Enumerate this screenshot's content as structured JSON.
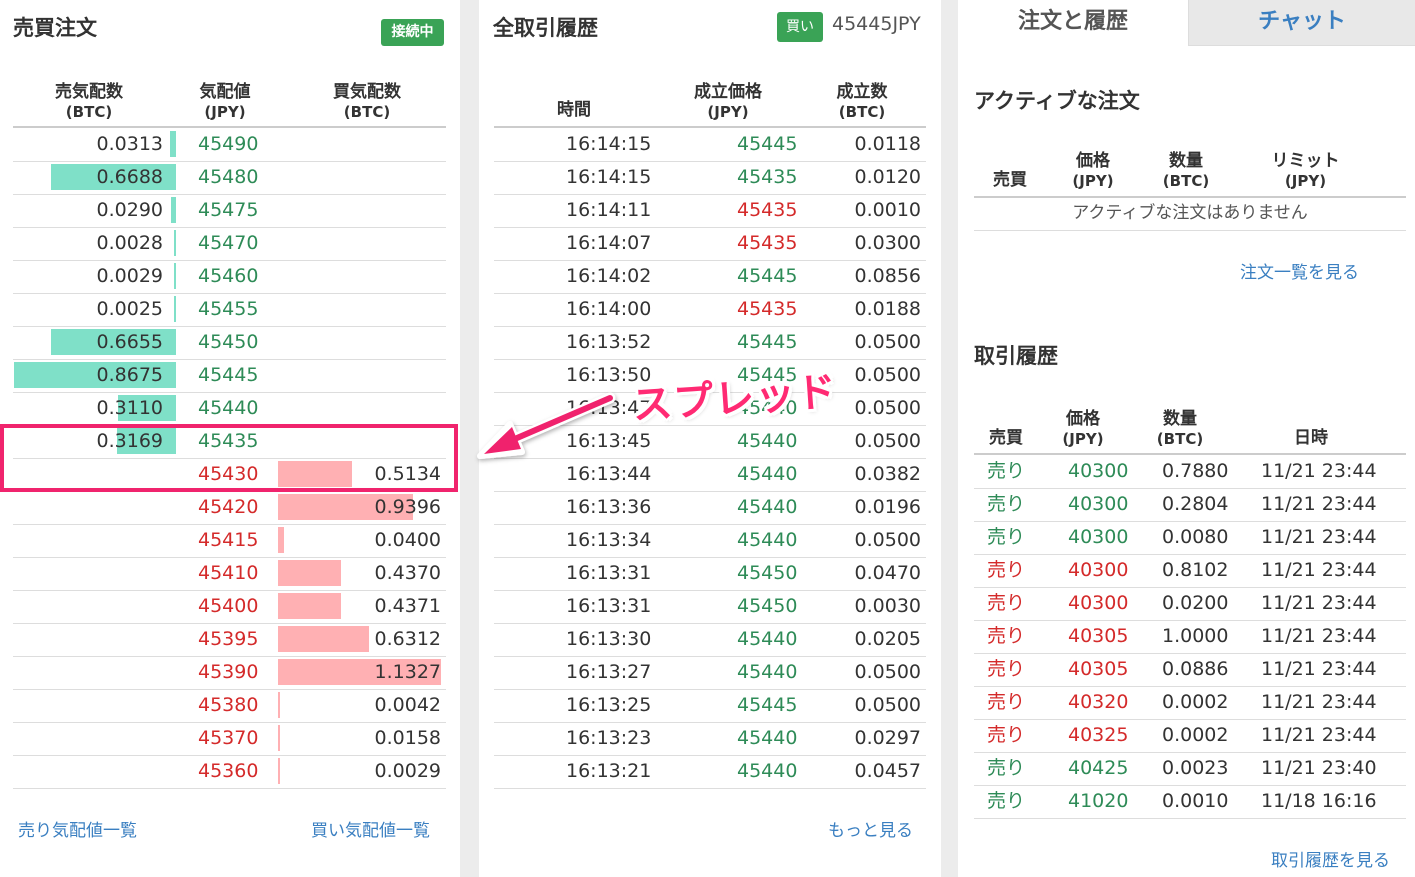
{
  "orderbook": {
    "title": "売買注文",
    "status_badge": "接続中",
    "headers": {
      "ask_qty": "売気配数",
      "ask_qty_unit": "(BTC)",
      "price": "気配値",
      "price_unit": "(JPY)",
      "bid_qty": "買気配数",
      "bid_qty_unit": "(BTC)"
    },
    "asks": [
      {
        "qty": "0.0313",
        "price": "45490",
        "level": 0.036
      },
      {
        "qty": "0.6688",
        "price": "45480",
        "level": 0.77
      },
      {
        "qty": "0.0290",
        "price": "45475",
        "level": 0.033
      },
      {
        "qty": "0.0028",
        "price": "45470",
        "level": 0.005
      },
      {
        "qty": "0.0029",
        "price": "45460",
        "level": 0.005
      },
      {
        "qty": "0.0025",
        "price": "45455",
        "level": 0.005
      },
      {
        "qty": "0.6655",
        "price": "45450",
        "level": 0.77
      },
      {
        "qty": "0.8675",
        "price": "45445",
        "level": 1.0
      },
      {
        "qty": "0.3110",
        "price": "45440",
        "level": 0.36
      },
      {
        "qty": "0.3169",
        "price": "45435",
        "level": 0.365
      }
    ],
    "bids": [
      {
        "price": "45430",
        "qty": "0.5134",
        "level": 0.453
      },
      {
        "price": "45420",
        "qty": "0.9396",
        "level": 0.83
      },
      {
        "price": "45415",
        "qty": "0.0400",
        "level": 0.035
      },
      {
        "price": "45410",
        "qty": "0.4370",
        "level": 0.386
      },
      {
        "price": "45400",
        "qty": "0.4371",
        "level": 0.386
      },
      {
        "price": "45395",
        "qty": "0.6312",
        "level": 0.557
      },
      {
        "price": "45390",
        "qty": "1.1327",
        "level": 1.0
      },
      {
        "price": "45380",
        "qty": "0.0042",
        "level": 0.004
      },
      {
        "price": "45370",
        "qty": "0.0158",
        "level": 0.014
      },
      {
        "price": "45360",
        "qty": "0.0029",
        "level": 0.003
      }
    ],
    "link_sell": "売り気配値一覧",
    "link_buy": "買い気配値一覧",
    "colors": {
      "ask_bar": "#7fe0c8",
      "bid_bar": "#ffb0b3",
      "highlight": "#f0246d"
    }
  },
  "annotation": {
    "spread_label": "スプレッド"
  },
  "trades": {
    "title": "全取引履歴",
    "side_badge": "買い",
    "last_price": "45445JPY",
    "headers": {
      "time": "時間",
      "price": "成立価格",
      "price_unit": "(JPY)",
      "qty": "成立数",
      "qty_unit": "(BTC)"
    },
    "rows": [
      {
        "time": "16:14:15",
        "price": "45445",
        "qty": "0.0118",
        "side": "buy"
      },
      {
        "time": "16:14:15",
        "price": "45435",
        "qty": "0.0120",
        "side": "buy"
      },
      {
        "time": "16:14:11",
        "price": "45435",
        "qty": "0.0010",
        "side": "sell"
      },
      {
        "time": "16:14:07",
        "price": "45435",
        "qty": "0.0300",
        "side": "sell"
      },
      {
        "time": "16:14:02",
        "price": "45445",
        "qty": "0.0856",
        "side": "buy"
      },
      {
        "time": "16:14:00",
        "price": "45435",
        "qty": "0.0188",
        "side": "sell"
      },
      {
        "time": "16:13:52",
        "price": "45445",
        "qty": "0.0500",
        "side": "buy"
      },
      {
        "time": "16:13:50",
        "price": "45445",
        "qty": "0.0500",
        "side": "buy"
      },
      {
        "time": "16:13:47",
        "price": "45440",
        "qty": "0.0500",
        "side": "buy"
      },
      {
        "time": "16:13:45",
        "price": "45440",
        "qty": "0.0500",
        "side": "buy"
      },
      {
        "time": "16:13:44",
        "price": "45440",
        "qty": "0.0382",
        "side": "buy"
      },
      {
        "time": "16:13:36",
        "price": "45440",
        "qty": "0.0196",
        "side": "buy"
      },
      {
        "time": "16:13:34",
        "price": "45440",
        "qty": "0.0500",
        "side": "buy"
      },
      {
        "time": "16:13:31",
        "price": "45450",
        "qty": "0.0470",
        "side": "buy"
      },
      {
        "time": "16:13:31",
        "price": "45450",
        "qty": "0.0030",
        "side": "buy"
      },
      {
        "time": "16:13:30",
        "price": "45440",
        "qty": "0.0205",
        "side": "buy"
      },
      {
        "time": "16:13:27",
        "price": "45440",
        "qty": "0.0500",
        "side": "buy"
      },
      {
        "time": "16:13:25",
        "price": "45445",
        "qty": "0.0500",
        "side": "buy"
      },
      {
        "time": "16:13:23",
        "price": "45440",
        "qty": "0.0297",
        "side": "buy"
      },
      {
        "time": "16:13:21",
        "price": "45440",
        "qty": "0.0457",
        "side": "buy"
      }
    ],
    "more_link": "もっと見る"
  },
  "right": {
    "tabs": [
      {
        "label": "注文と履歴",
        "active": true
      },
      {
        "label": "チャット",
        "active": false
      }
    ],
    "active_title": "アクティブな注文",
    "active_headers": {
      "side": "売買",
      "price": "価格",
      "price_unit": "(JPY)",
      "qty": "数量",
      "qty_unit": "(BTC)",
      "limit": "リミット",
      "limit_unit": "(JPY)"
    },
    "no_orders": "アクティブな注文はありません",
    "orders_link": "注文一覧を見る",
    "history_title": "取引履歴",
    "history_headers": {
      "side": "売買",
      "price": "価格",
      "price_unit": "(JPY)",
      "qty": "数量",
      "qty_unit": "(BTC)",
      "datetime": "日時"
    },
    "history": [
      {
        "side": "売り",
        "price": "40300",
        "qty": "0.7880",
        "datetime": "11/21 23:44",
        "color": "green"
      },
      {
        "side": "売り",
        "price": "40300",
        "qty": "0.2804",
        "datetime": "11/21 23:44",
        "color": "green"
      },
      {
        "side": "売り",
        "price": "40300",
        "qty": "0.0080",
        "datetime": "11/21 23:44",
        "color": "green"
      },
      {
        "side": "売り",
        "price": "40300",
        "qty": "0.8102",
        "datetime": "11/21 23:44",
        "color": "red"
      },
      {
        "side": "売り",
        "price": "40300",
        "qty": "0.0200",
        "datetime": "11/21 23:44",
        "color": "red"
      },
      {
        "side": "売り",
        "price": "40305",
        "qty": "1.0000",
        "datetime": "11/21 23:44",
        "color": "red"
      },
      {
        "side": "売り",
        "price": "40305",
        "qty": "0.0886",
        "datetime": "11/21 23:44",
        "color": "red"
      },
      {
        "side": "売り",
        "price": "40320",
        "qty": "0.0002",
        "datetime": "11/21 23:44",
        "color": "red"
      },
      {
        "side": "売り",
        "price": "40325",
        "qty": "0.0002",
        "datetime": "11/21 23:44",
        "color": "red"
      },
      {
        "side": "売り",
        "price": "40425",
        "qty": "0.0023",
        "datetime": "11/21 23:40",
        "color": "green"
      },
      {
        "side": "売り",
        "price": "41020",
        "qty": "0.0010",
        "datetime": "11/18 16:16",
        "color": "green"
      }
    ],
    "history_link": "取引履歴を見る"
  }
}
